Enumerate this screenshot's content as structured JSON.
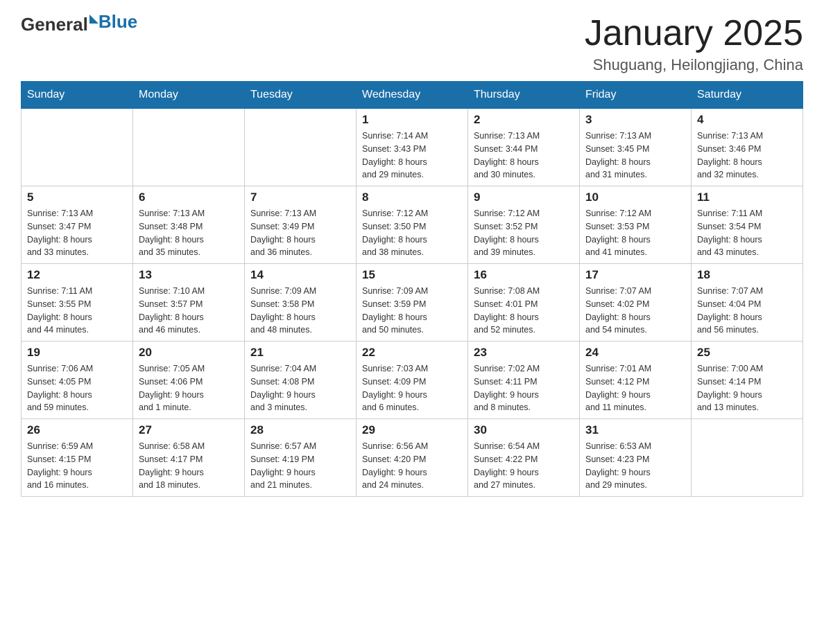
{
  "header": {
    "logo": {
      "general": "General",
      "blue": "Blue"
    },
    "title": "January 2025",
    "location": "Shuguang, Heilongjiang, China"
  },
  "weekdays": [
    "Sunday",
    "Monday",
    "Tuesday",
    "Wednesday",
    "Thursday",
    "Friday",
    "Saturday"
  ],
  "weeks": [
    [
      {
        "day": "",
        "info": ""
      },
      {
        "day": "",
        "info": ""
      },
      {
        "day": "",
        "info": ""
      },
      {
        "day": "1",
        "info": "Sunrise: 7:14 AM\nSunset: 3:43 PM\nDaylight: 8 hours\nand 29 minutes."
      },
      {
        "day": "2",
        "info": "Sunrise: 7:13 AM\nSunset: 3:44 PM\nDaylight: 8 hours\nand 30 minutes."
      },
      {
        "day": "3",
        "info": "Sunrise: 7:13 AM\nSunset: 3:45 PM\nDaylight: 8 hours\nand 31 minutes."
      },
      {
        "day": "4",
        "info": "Sunrise: 7:13 AM\nSunset: 3:46 PM\nDaylight: 8 hours\nand 32 minutes."
      }
    ],
    [
      {
        "day": "5",
        "info": "Sunrise: 7:13 AM\nSunset: 3:47 PM\nDaylight: 8 hours\nand 33 minutes."
      },
      {
        "day": "6",
        "info": "Sunrise: 7:13 AM\nSunset: 3:48 PM\nDaylight: 8 hours\nand 35 minutes."
      },
      {
        "day": "7",
        "info": "Sunrise: 7:13 AM\nSunset: 3:49 PM\nDaylight: 8 hours\nand 36 minutes."
      },
      {
        "day": "8",
        "info": "Sunrise: 7:12 AM\nSunset: 3:50 PM\nDaylight: 8 hours\nand 38 minutes."
      },
      {
        "day": "9",
        "info": "Sunrise: 7:12 AM\nSunset: 3:52 PM\nDaylight: 8 hours\nand 39 minutes."
      },
      {
        "day": "10",
        "info": "Sunrise: 7:12 AM\nSunset: 3:53 PM\nDaylight: 8 hours\nand 41 minutes."
      },
      {
        "day": "11",
        "info": "Sunrise: 7:11 AM\nSunset: 3:54 PM\nDaylight: 8 hours\nand 43 minutes."
      }
    ],
    [
      {
        "day": "12",
        "info": "Sunrise: 7:11 AM\nSunset: 3:55 PM\nDaylight: 8 hours\nand 44 minutes."
      },
      {
        "day": "13",
        "info": "Sunrise: 7:10 AM\nSunset: 3:57 PM\nDaylight: 8 hours\nand 46 minutes."
      },
      {
        "day": "14",
        "info": "Sunrise: 7:09 AM\nSunset: 3:58 PM\nDaylight: 8 hours\nand 48 minutes."
      },
      {
        "day": "15",
        "info": "Sunrise: 7:09 AM\nSunset: 3:59 PM\nDaylight: 8 hours\nand 50 minutes."
      },
      {
        "day": "16",
        "info": "Sunrise: 7:08 AM\nSunset: 4:01 PM\nDaylight: 8 hours\nand 52 minutes."
      },
      {
        "day": "17",
        "info": "Sunrise: 7:07 AM\nSunset: 4:02 PM\nDaylight: 8 hours\nand 54 minutes."
      },
      {
        "day": "18",
        "info": "Sunrise: 7:07 AM\nSunset: 4:04 PM\nDaylight: 8 hours\nand 56 minutes."
      }
    ],
    [
      {
        "day": "19",
        "info": "Sunrise: 7:06 AM\nSunset: 4:05 PM\nDaylight: 8 hours\nand 59 minutes."
      },
      {
        "day": "20",
        "info": "Sunrise: 7:05 AM\nSunset: 4:06 PM\nDaylight: 9 hours\nand 1 minute."
      },
      {
        "day": "21",
        "info": "Sunrise: 7:04 AM\nSunset: 4:08 PM\nDaylight: 9 hours\nand 3 minutes."
      },
      {
        "day": "22",
        "info": "Sunrise: 7:03 AM\nSunset: 4:09 PM\nDaylight: 9 hours\nand 6 minutes."
      },
      {
        "day": "23",
        "info": "Sunrise: 7:02 AM\nSunset: 4:11 PM\nDaylight: 9 hours\nand 8 minutes."
      },
      {
        "day": "24",
        "info": "Sunrise: 7:01 AM\nSunset: 4:12 PM\nDaylight: 9 hours\nand 11 minutes."
      },
      {
        "day": "25",
        "info": "Sunrise: 7:00 AM\nSunset: 4:14 PM\nDaylight: 9 hours\nand 13 minutes."
      }
    ],
    [
      {
        "day": "26",
        "info": "Sunrise: 6:59 AM\nSunset: 4:15 PM\nDaylight: 9 hours\nand 16 minutes."
      },
      {
        "day": "27",
        "info": "Sunrise: 6:58 AM\nSunset: 4:17 PM\nDaylight: 9 hours\nand 18 minutes."
      },
      {
        "day": "28",
        "info": "Sunrise: 6:57 AM\nSunset: 4:19 PM\nDaylight: 9 hours\nand 21 minutes."
      },
      {
        "day": "29",
        "info": "Sunrise: 6:56 AM\nSunset: 4:20 PM\nDaylight: 9 hours\nand 24 minutes."
      },
      {
        "day": "30",
        "info": "Sunrise: 6:54 AM\nSunset: 4:22 PM\nDaylight: 9 hours\nand 27 minutes."
      },
      {
        "day": "31",
        "info": "Sunrise: 6:53 AM\nSunset: 4:23 PM\nDaylight: 9 hours\nand 29 minutes."
      },
      {
        "day": "",
        "info": ""
      }
    ]
  ]
}
